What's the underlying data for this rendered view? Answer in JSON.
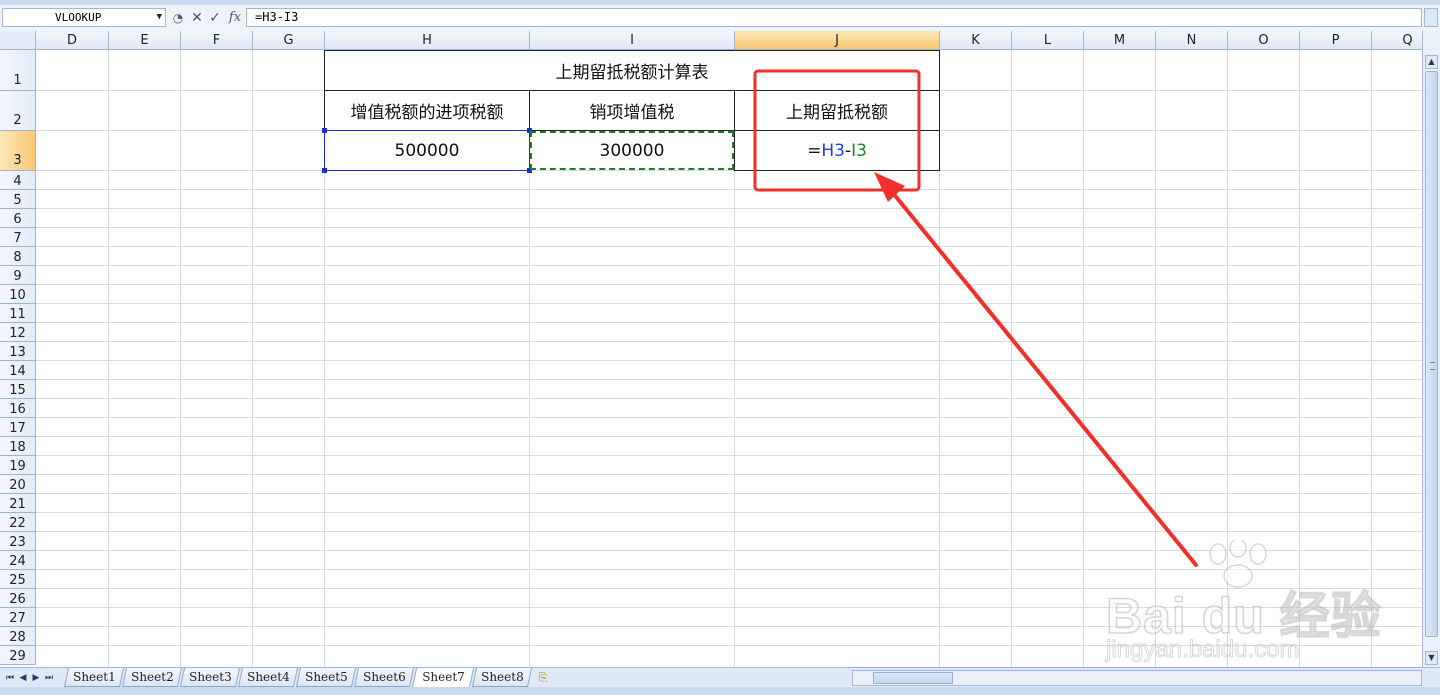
{
  "formula_bar": {
    "name_box": "VLOOKUP",
    "cancel_glyph": "✕",
    "enter_glyph": "✓",
    "fx_label": "fx",
    "formula": "=H3-I3"
  },
  "columns": [
    "D",
    "E",
    "F",
    "G",
    "H",
    "I",
    "J",
    "K",
    "L",
    "M",
    "N",
    "O",
    "P",
    "Q"
  ],
  "active_column": "J",
  "rows": [
    "1",
    "2",
    "3",
    "4",
    "5",
    "6",
    "7",
    "8",
    "9",
    "10",
    "11",
    "12",
    "13",
    "14",
    "15",
    "16",
    "17",
    "18",
    "19",
    "20",
    "21",
    "22",
    "23",
    "24",
    "25",
    "26",
    "27",
    "28",
    "29"
  ],
  "active_row": "3",
  "table": {
    "title": "上期留抵税额计算表",
    "headers": [
      "增值税额的进项税额",
      "销项增值税",
      "上期留抵税额"
    ],
    "values": {
      "h3": "500000",
      "i3": "300000"
    },
    "formula_parts": {
      "eq": "=",
      "ref1": "H3",
      "op": "-",
      "ref2": "I3"
    }
  },
  "sheet_tabs": [
    "Sheet1",
    "Sheet2",
    "Sheet3",
    "Sheet4",
    "Sheet5",
    "Sheet6",
    "Sheet7",
    "Sheet8"
  ],
  "active_sheet": "Sheet7",
  "colors": {
    "annotation_red": "#f0302a",
    "ref_h_color": "#1f3fe0",
    "ref_i_color": "#14892a",
    "active_header": "#f7c873"
  },
  "watermark": {
    "logo_text": "Bai du 经验",
    "url_text": "jingyan.baidu.com"
  }
}
